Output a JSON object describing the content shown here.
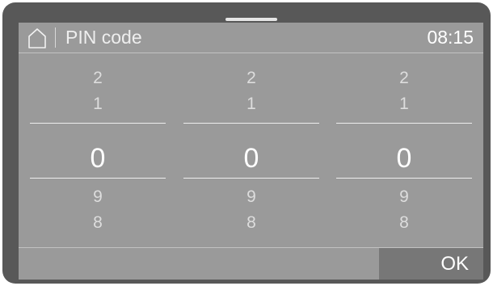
{
  "header": {
    "home_icon": "home-icon",
    "title": "PIN code",
    "time": "08:15"
  },
  "pin_columns": [
    {
      "above": [
        "2",
        "1"
      ],
      "selected": "0",
      "below": [
        "9",
        "8"
      ]
    },
    {
      "above": [
        "2",
        "1"
      ],
      "selected": "0",
      "below": [
        "9",
        "8"
      ]
    },
    {
      "above": [
        "2",
        "1"
      ],
      "selected": "0",
      "below": [
        "9",
        "8"
      ]
    }
  ],
  "footer": {
    "ok_label": "OK"
  }
}
